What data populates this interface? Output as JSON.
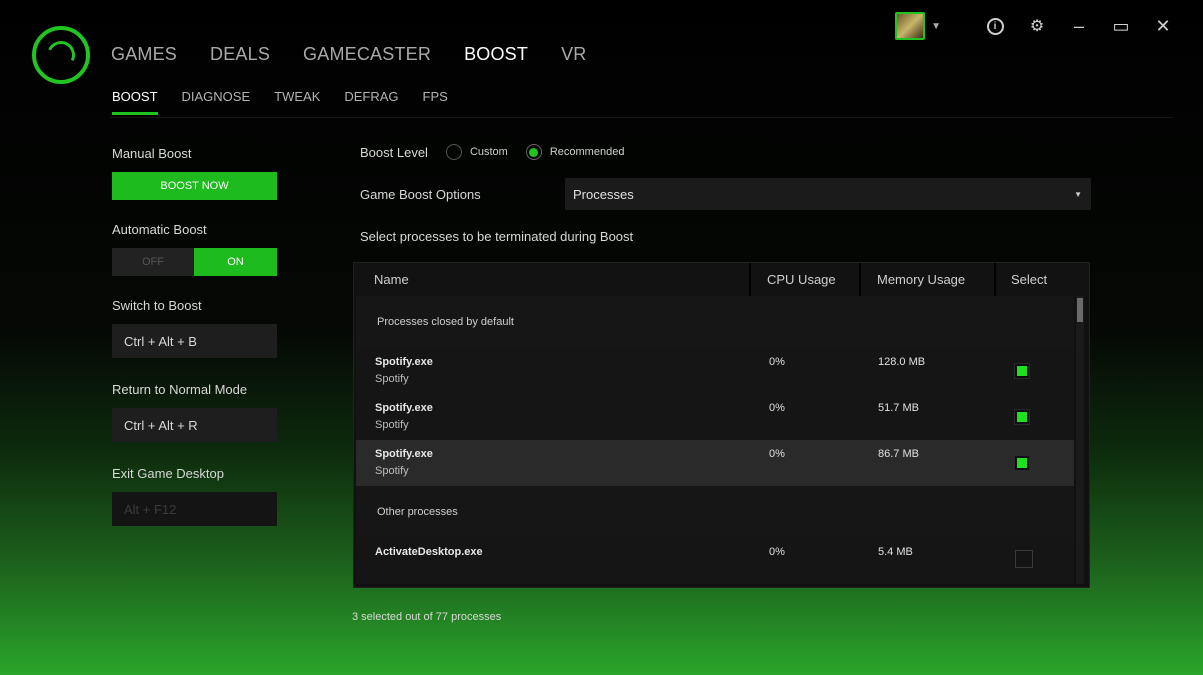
{
  "nav": {
    "items": [
      "GAMES",
      "DEALS",
      "GAMECASTER",
      "BOOST",
      "VR"
    ],
    "active": "BOOST"
  },
  "subnav": {
    "items": [
      "BOOST",
      "DIAGNOSE",
      "TWEAK",
      "DEFRAG",
      "FPS"
    ],
    "active": "BOOST"
  },
  "left": {
    "manual_boost_label": "Manual Boost",
    "boost_now_label": "BOOST NOW",
    "automatic_boost_label": "Automatic Boost",
    "toggle_off_label": "OFF",
    "toggle_on_label": "ON",
    "toggle_state": "ON",
    "switch_to_boost_label": "Switch to Boost",
    "switch_to_boost_hotkey": "Ctrl + Alt + B",
    "return_normal_label": "Return to Normal Mode",
    "return_normal_hotkey": "Ctrl + Alt + R",
    "exit_desktop_label": "Exit Game Desktop",
    "exit_desktop_hotkey": "Alt + F12"
  },
  "boost": {
    "level_label": "Boost Level",
    "level_options": [
      "Custom",
      "Recommended"
    ],
    "level_selected": "Recommended",
    "options_label": "Game Boost Options",
    "options_value": "Processes",
    "select_prompt": "Select processes to be terminated during Boost"
  },
  "table": {
    "headers": {
      "name": "Name",
      "cpu": "CPU Usage",
      "memory": "Memory Usage",
      "select": "Select"
    },
    "group_default": "Processes closed by default",
    "default_rows": [
      {
        "name": "Spotify.exe",
        "sub": "Spotify",
        "cpu": "0%",
        "mem": "128.0 MB",
        "selected": true
      },
      {
        "name": "Spotify.exe",
        "sub": "Spotify",
        "cpu": "0%",
        "mem": "51.7 MB",
        "selected": true
      },
      {
        "name": "Spotify.exe",
        "sub": "Spotify",
        "cpu": "0%",
        "mem": "86.7 MB",
        "selected": true
      }
    ],
    "group_other": "Other processes",
    "other_rows": [
      {
        "name": "ActivateDesktop.exe",
        "sub": "",
        "cpu": "0%",
        "mem": "5.4 MB",
        "selected": false
      }
    ]
  },
  "status": "3 selected out of 77 processes",
  "colors": {
    "accent": "#1fc41f",
    "background": "#000000"
  },
  "icons": [
    "logo-icon",
    "avatar",
    "info-icon",
    "gear-icon",
    "minimize-icon",
    "maximize-icon",
    "close-icon"
  ]
}
